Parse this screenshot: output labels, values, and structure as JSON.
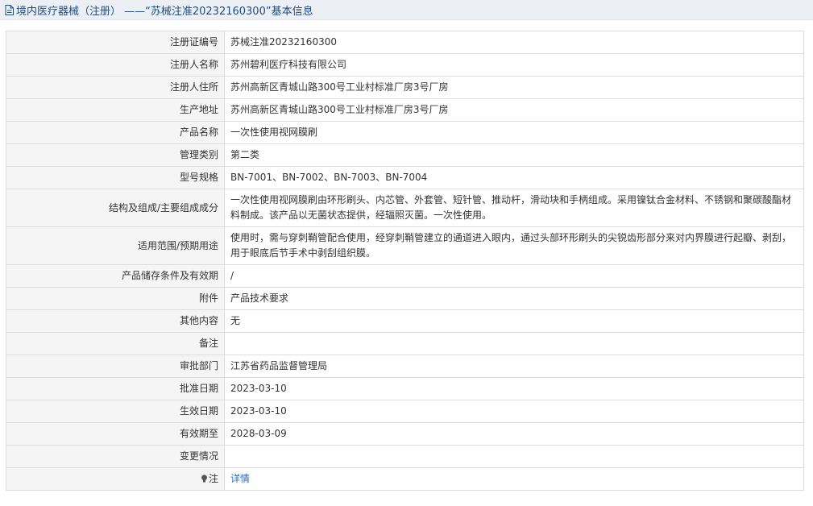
{
  "header": {
    "icon": "document-icon",
    "title": "境内医疗器械（注册） ——“苏械注准20232160300”基本信息"
  },
  "rows": [
    {
      "label": "注册证编号",
      "value": "苏械注准20232160300"
    },
    {
      "label": "注册人名称",
      "value": "苏州碧利医疗科技有限公司"
    },
    {
      "label": "注册人住所",
      "value": "苏州高新区青城山路300号工业村标准厂房3号厂房"
    },
    {
      "label": "生产地址",
      "value": "苏州高新区青城山路300号工业村标准厂房3号厂房"
    },
    {
      "label": "产品名称",
      "value": "一次性使用视网膜刷"
    },
    {
      "label": "管理类别",
      "value": "第二类"
    },
    {
      "label": "型号规格",
      "value": "BN-7001、BN-7002、BN-7003、BN-7004"
    },
    {
      "label": "结构及组成/主要组成成分",
      "value": "一次性使用视网膜刷由环形刷头、内芯管、外套管、短针管、推动杆，滑动块和手柄组成。采用镍钛合金材料、不锈钢和聚碳酸酯材料制成。该产品以无菌状态提供，经辐照灭菌。一次性使用。"
    },
    {
      "label": "适用范围/预期用途",
      "value": "使用时，需与穿刺鞘管配合使用，经穿刺鞘管建立的通道进入眼内，通过头部环形刷头的尖锐齿形部分来对内界膜进行起瓣、剥刮，用于眼底后节手术中剥刮组织膜。"
    },
    {
      "label": "产品储存条件及有效期",
      "value": "/"
    },
    {
      "label": "附件",
      "value": "产品技术要求"
    },
    {
      "label": "其他内容",
      "value": "无"
    },
    {
      "label": "备注",
      "value": ""
    },
    {
      "label": "审批部门",
      "value": "江苏省药品监督管理局"
    },
    {
      "label": "批准日期",
      "value": "2023-03-10"
    },
    {
      "label": "生效日期",
      "value": "2023-03-10"
    },
    {
      "label": "有效期至",
      "value": "2028-03-09"
    },
    {
      "label": "变更情况",
      "value": ""
    }
  ],
  "note_row": {
    "icon": "lightbulb-icon",
    "label": "注",
    "link_text": "详情"
  },
  "colors": {
    "header_bg": "#ecf0f5",
    "header_text": "#1e4c82",
    "label_bg": "#f5f5f5",
    "border": "#dcdcdc",
    "link": "#2a6ebb"
  }
}
